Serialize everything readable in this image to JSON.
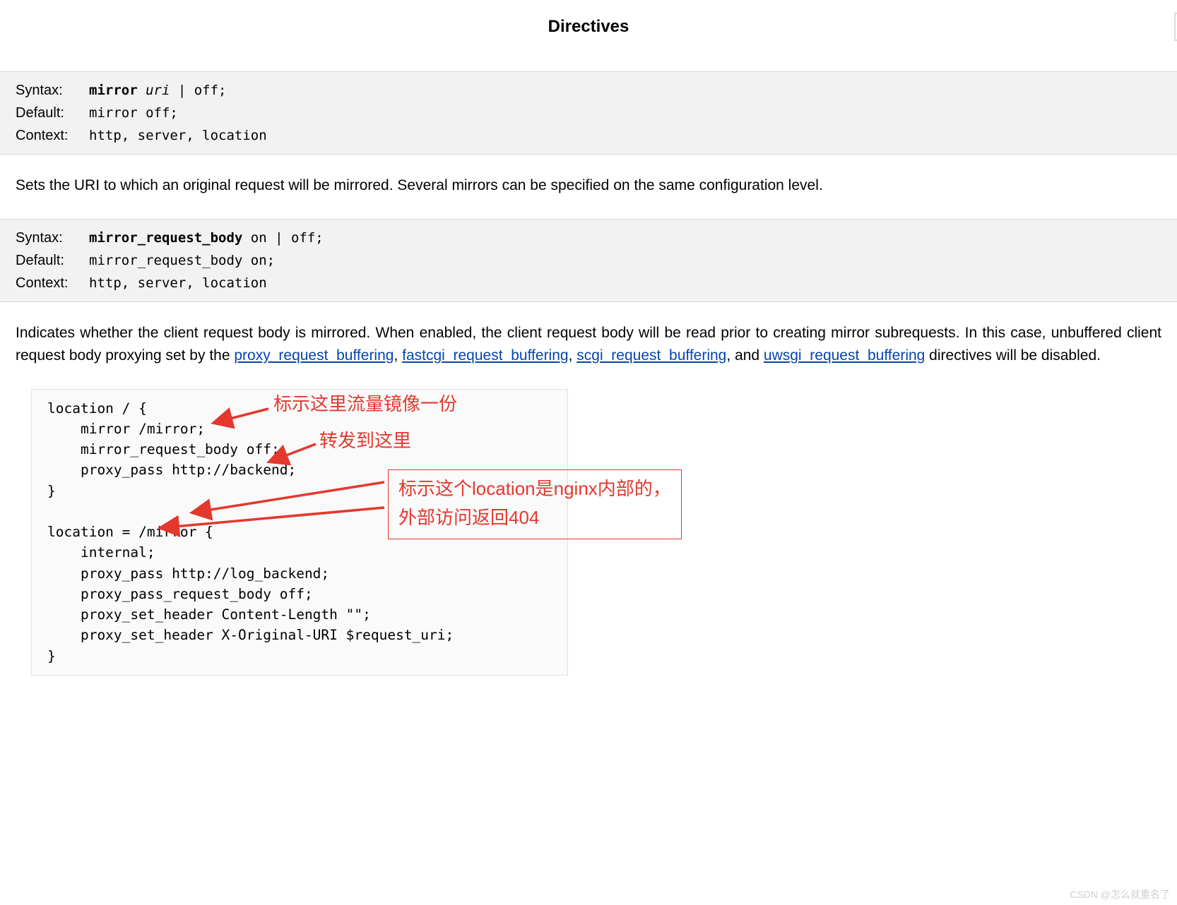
{
  "title": "Directives",
  "directive1": {
    "syntax_label": "Syntax:",
    "syntax_keyword": "mirror",
    "syntax_arg": "uri",
    "syntax_rest": " | off;",
    "default_label": "Default:",
    "default_value": "mirror off;",
    "context_label": "Context:",
    "context_value": "http, server, location"
  },
  "description1": "Sets the URI to which an original request will be mirrored. Several mirrors can be specified on the same configuration level.",
  "directive2": {
    "syntax_label": "Syntax:",
    "syntax_keyword": "mirror_request_body",
    "syntax_rest": " on | off;",
    "default_label": "Default:",
    "default_value": "mirror_request_body on;",
    "context_label": "Context:",
    "context_value": "http, server, location"
  },
  "description2_a": "Indicates whether the client request body is mirrored. When enabled, the client request body will be read prior to creating mirror subrequests. In this case, unbuffered client request body proxying set by the ",
  "links": {
    "l1": "proxy_request_buffering",
    "l2": "fastcgi_request_buffering",
    "l3": "scgi_request_buffering",
    "l4": "uwsgi_request_buffering"
  },
  "description2_b": " directives will be disabled.",
  "example_code": "location / {\n    mirror /mirror;\n    mirror_request_body off;\n    proxy_pass http://backend;\n}\n\nlocation = /mirror {\n    internal;\n    proxy_pass http://log_backend;\n    proxy_pass_request_body off;\n    proxy_set_header Content-Length \"\";\n    proxy_set_header X-Original-URI $request_uri;\n}",
  "annotations": {
    "a1": "标示这里流量镜像一份",
    "a2": "转发到这里",
    "a3_line1": "标示这个location是nginx内部的，",
    "a3_line2": "外部访问返回404"
  },
  "watermark": "CSDN @怎么就重名了"
}
